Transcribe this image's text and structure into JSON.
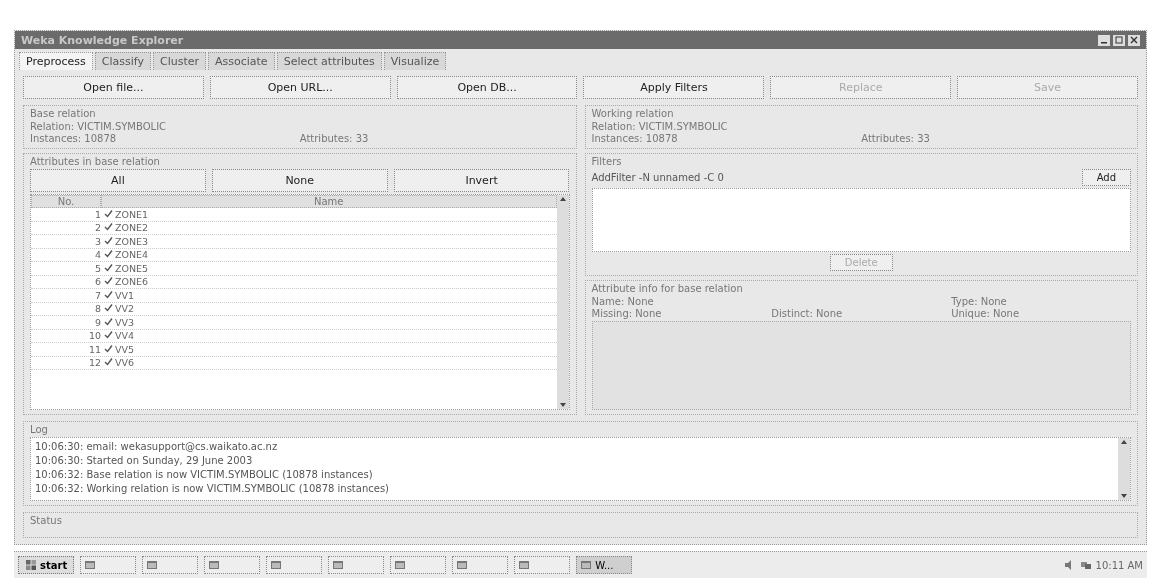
{
  "window": {
    "title": "Weka Knowledge Explorer"
  },
  "tabs": [
    {
      "label": "Preprocess",
      "selected": true
    },
    {
      "label": "Classify",
      "selected": false
    },
    {
      "label": "Cluster",
      "selected": false
    },
    {
      "label": "Associate",
      "selected": false
    },
    {
      "label": "Select attributes",
      "selected": false
    },
    {
      "label": "Visualize",
      "selected": false
    }
  ],
  "toolbar": [
    {
      "label": "Open file...",
      "disabled": false
    },
    {
      "label": "Open URL...",
      "disabled": false
    },
    {
      "label": "Open DB...",
      "disabled": false
    },
    {
      "label": "Apply Filters",
      "disabled": false
    },
    {
      "label": "Replace",
      "disabled": true
    },
    {
      "label": "Save",
      "disabled": true
    }
  ],
  "base_relation": {
    "title": "Base relation",
    "relation_label": "Relation:",
    "relation": "VICTIM.SYMBOLIC",
    "instances_label": "Instances:",
    "instances": "10878",
    "attributes_label": "Attributes:",
    "attributes": "33"
  },
  "working_relation": {
    "title": "Working relation",
    "relation_label": "Relation:",
    "relation": "VICTIM.SYMBOLIC",
    "instances_label": "Instances:",
    "instances": "10878",
    "attributes_label": "Attributes:",
    "attributes": "33"
  },
  "attributes_panel": {
    "title": "Attributes in base relation",
    "buttons": [
      "All",
      "None",
      "Invert"
    ],
    "columns": [
      "No.",
      "Name"
    ],
    "rows": [
      {
        "no": "1",
        "name": "ZONE1",
        "checked": true
      },
      {
        "no": "2",
        "name": "ZONE2",
        "checked": true
      },
      {
        "no": "3",
        "name": "ZONE3",
        "checked": true
      },
      {
        "no": "4",
        "name": "ZONE4",
        "checked": true
      },
      {
        "no": "5",
        "name": "ZONE5",
        "checked": true
      },
      {
        "no": "6",
        "name": "ZONE6",
        "checked": true
      },
      {
        "no": "7",
        "name": "VV1",
        "checked": true
      },
      {
        "no": "8",
        "name": "VV2",
        "checked": true
      },
      {
        "no": "9",
        "name": "VV3",
        "checked": true
      },
      {
        "no": "10",
        "name": "VV4",
        "checked": true
      },
      {
        "no": "11",
        "name": "VV5",
        "checked": true
      },
      {
        "no": "12",
        "name": "VV6",
        "checked": true
      }
    ]
  },
  "filters": {
    "title": "Filters",
    "filter": "AddFilter -N unnamed -C 0",
    "add": "Add",
    "delete": {
      "label": "Delete",
      "disabled": true
    }
  },
  "attribute_info": {
    "title": "Attribute info for base relation",
    "fields": [
      {
        "label": "Name:",
        "value": "None"
      },
      {
        "label": "Type:",
        "value": "None"
      },
      {
        "label": "Missing:",
        "value": "None"
      },
      {
        "label": "Distinct:",
        "value": "None"
      },
      {
        "label": "Unique:",
        "value": "None"
      }
    ]
  },
  "log": {
    "title": "Log",
    "lines": [
      "10:06:30: email: wekasupport@cs.waikato.ac.nz",
      "10:06:30: Started on Sunday, 29 June 2003",
      "10:06:32: Base relation is now VICTIM.SYMBOLIC (10878 instances)",
      "10:06:32: Working relation is now VICTIM.SYMBOLIC (10878 instances)"
    ]
  },
  "status": {
    "title": "Status"
  },
  "taskbar": {
    "start": "start",
    "tasks": [
      {
        "selected": false
      },
      {
        "selected": false
      },
      {
        "selected": false
      },
      {
        "selected": false
      },
      {
        "selected": false
      },
      {
        "selected": false
      },
      {
        "selected": false
      },
      {
        "selected": false
      },
      {
        "label": "W...",
        "selected": true
      }
    ],
    "clock": "10:11 AM"
  }
}
